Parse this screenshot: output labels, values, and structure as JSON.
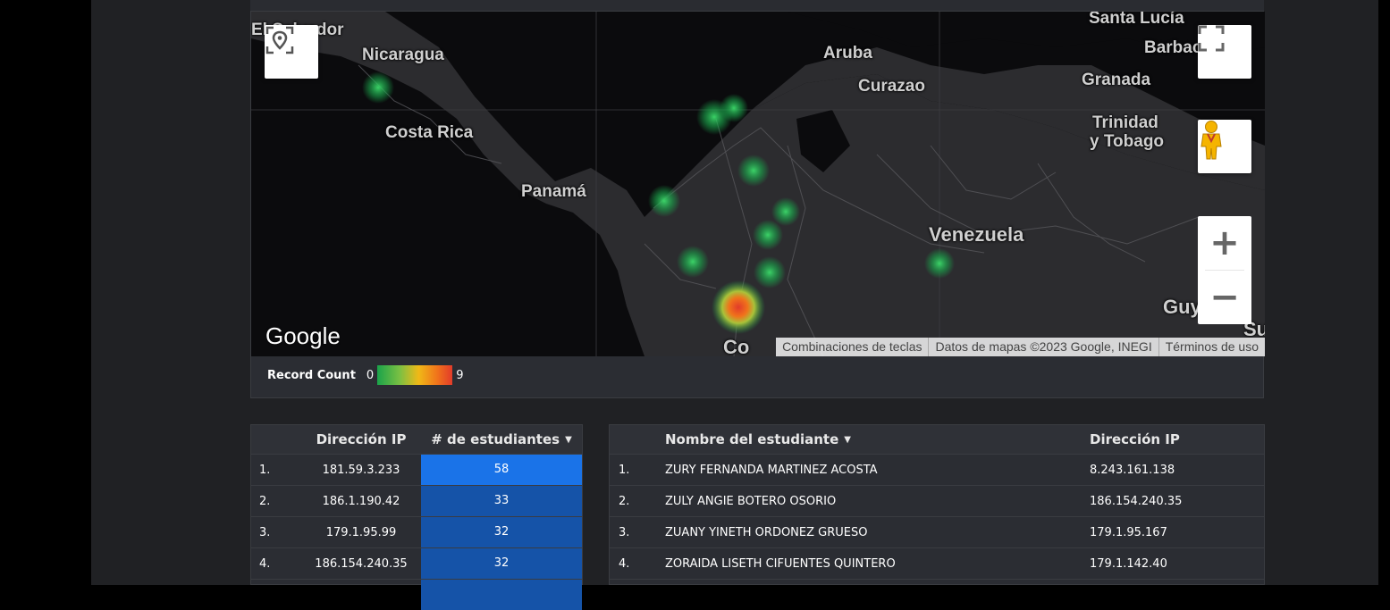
{
  "map": {
    "labels": {
      "el_salvador": "El Salvador",
      "nicaragua": "Nicaragua",
      "costa_rica": "Costa Rica",
      "panama": "Panamá",
      "aruba": "Aruba",
      "curazao": "Curazao",
      "santa_lucia": "Santa Lucía",
      "barbados": "Barbac",
      "granada": "Granada",
      "trinidad_1": "Trinidad",
      "trinidad_2": "y Tobago",
      "venezuela": "Venezuela",
      "guyana": "Guy",
      "colombia": "Co",
      "su": "Su"
    },
    "controls": {
      "location_icon": "location-pin-icon",
      "fullscreen_icon": "fullscreen-icon",
      "pegman_icon": "street-view-pegman-icon",
      "zoom_in": "+",
      "zoom_out": "−"
    },
    "google_logo": "Google",
    "attribution": {
      "shortcuts": "Combinaciones de teclas",
      "data": "Datos de mapas ©2023 Google, INEGI",
      "terms": "Términos de uso"
    },
    "legend": {
      "title": "Record Count",
      "min": "0",
      "max": "9",
      "colors": [
        "#1aa34a",
        "#7bc043",
        "#f0b917",
        "#f0731b",
        "#e23b2a"
      ]
    }
  },
  "table_ips": {
    "headers": {
      "index": "",
      "ip": "Dirección IP",
      "count": "# de estudiantes"
    },
    "sort_icon": "sort-desc-icon",
    "rows": [
      {
        "n": "1.",
        "ip": "181.59.3.233",
        "count": "58"
      },
      {
        "n": "2.",
        "ip": "186.1.190.42",
        "count": "33"
      },
      {
        "n": "3.",
        "ip": "179.1.95.99",
        "count": "32"
      },
      {
        "n": "4.",
        "ip": "186.154.240.35",
        "count": "32"
      }
    ]
  },
  "table_students": {
    "headers": {
      "index": "",
      "name": "Nombre del estudiante",
      "ip": "Dirección IP"
    },
    "sort_icon": "sort-desc-icon",
    "rows": [
      {
        "n": "1.",
        "name": "ZURY FERNANDA MARTINEZ ACOSTA",
        "ip": "8.243.161.138"
      },
      {
        "n": "2.",
        "name": "ZULY ANGIE BOTERO OSORIO",
        "ip": "186.154.240.35"
      },
      {
        "n": "3.",
        "name": "ZUANY YINETH ORDONEZ GRUESO",
        "ip": "179.1.95.167"
      },
      {
        "n": "4.",
        "name": "ZORAIDA LISETH CIFUENTES QUINTERO",
        "ip": "179.1.142.40"
      }
    ]
  },
  "colors": {
    "page_bg": "#202124",
    "bar_highlight": "#1a73e8",
    "bar_normal": "#1553a8"
  }
}
